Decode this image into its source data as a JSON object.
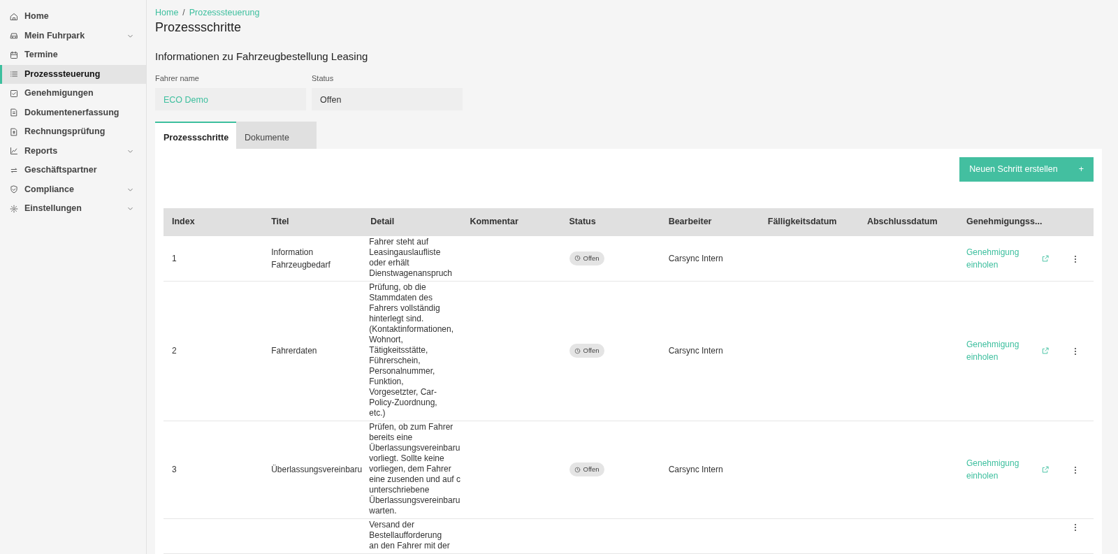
{
  "sidebar": {
    "items": [
      {
        "label": "Home",
        "kind": "link",
        "selected": false
      },
      {
        "label": "Mein Fuhrpark",
        "kind": "group",
        "selected": false,
        "expanded": false
      },
      {
        "label": "Termine",
        "kind": "link",
        "selected": false
      },
      {
        "label": "Prozesssteuerung",
        "kind": "link",
        "selected": true
      },
      {
        "label": "Genehmigungen",
        "kind": "link",
        "selected": false
      },
      {
        "label": "Dokumentenerfassung",
        "kind": "link",
        "selected": false
      },
      {
        "label": "Rechnungsprüfung",
        "kind": "link",
        "selected": false
      },
      {
        "label": "Reports",
        "kind": "group",
        "selected": false,
        "expanded": false
      },
      {
        "label": "Geschäftspartner",
        "kind": "link",
        "selected": false
      },
      {
        "label": "Compliance",
        "kind": "group",
        "selected": false,
        "expanded": false
      },
      {
        "label": "Einstellungen",
        "kind": "group",
        "selected": false,
        "expanded": false
      }
    ]
  },
  "breadcrumb": [
    "Home",
    "Prozesssteuerung"
  ],
  "breadcrumb_separator": "/",
  "page_title": "Prozessschritte",
  "section_title": "Informationen zu Fahrzeugbestellung Leasing",
  "fields": [
    {
      "label": "Fahrer name",
      "value": "ECO Demo",
      "kind": "link"
    },
    {
      "label": "Status",
      "value": "Offen",
      "kind": "text"
    }
  ],
  "tabs": [
    {
      "label": "Prozessschritte",
      "selected": true
    },
    {
      "label": "Dokumente",
      "selected": false
    }
  ],
  "create_button": {
    "label": "Neuen Schritt erstellen",
    "icon": "+"
  },
  "table": {
    "columns": [
      "Index",
      "Titel",
      "Detail",
      "Kommentar",
      "Status",
      "Bearbeiter",
      "Fälligkeitsdatum",
      "Abschlussdatum",
      "Genehmigungss..."
    ],
    "rows": [
      {
        "index": "1",
        "title": "Information Fahrzeugbedarf",
        "detail": [
          "Fahrer steht auf",
          "Leasingauslaufliste",
          "oder erhält",
          "Dienstwagenanspruch"
        ],
        "status": "Offen",
        "assignee": "Carsync Intern",
        "approval": "Genehmigung einholen"
      },
      {
        "index": "2",
        "title": "Fahrerdaten",
        "detail": [
          "Prüfung, ob die",
          "Stammdaten des",
          "Fahrers vollständig",
          "hinterlegt sind.",
          "(Kontaktinformationen,",
          "Wohnort,",
          "Tätigkeitsstätte,",
          "Führerschein,",
          "Personalnummer,",
          "Funktion,",
          "Vorgesetzter, Car-",
          "Policy-Zuordnung,",
          "etc.)"
        ],
        "status": "Offen",
        "assignee": "Carsync Intern",
        "approval": "Genehmigung einholen"
      },
      {
        "index": "3",
        "title": "Überlassungsvereinbaru",
        "detail": [
          "Prüfen, ob zum Fahrer",
          "bereits eine",
          "Überlassungsvereinbaru",
          "vorliegt. Sollte keine",
          "vorliegen, dem Fahrer",
          "eine zusenden und auf c",
          "unterschriebene",
          "Überlassungsvereinbaru",
          "warten."
        ],
        "status": "Offen",
        "assignee": "Carsync Intern",
        "approval": "Genehmigung einholen"
      },
      {
        "detail": [
          "Versand der",
          "Bestellaufforderung",
          "an den Fahrer mit der"
        ]
      }
    ]
  }
}
